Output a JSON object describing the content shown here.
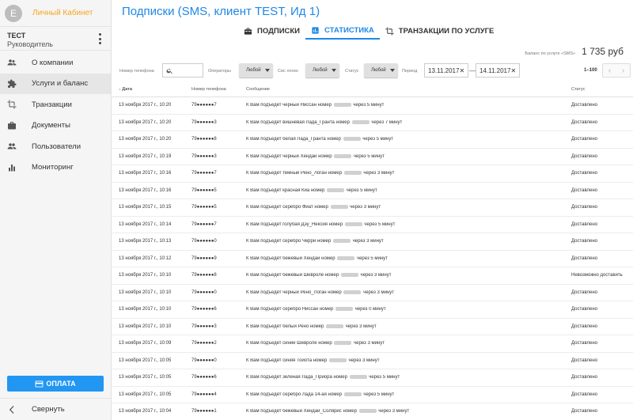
{
  "sidebar": {
    "avatar_letter": "E",
    "cabinet_label": "Личный Кабинет",
    "user_name": "ТЕСТ",
    "user_role": "Руководитель",
    "items": [
      {
        "label": "О компании",
        "icon": "users-icon"
      },
      {
        "label": "Услуги и баланс",
        "icon": "puzzle-icon",
        "active": true
      },
      {
        "label": "Транзакции",
        "icon": "crop-icon"
      },
      {
        "label": "Документы",
        "icon": "briefcase-icon"
      },
      {
        "label": "Пользователи",
        "icon": "people-icon"
      },
      {
        "label": "Мониторинг",
        "icon": "bar-chart-icon"
      }
    ],
    "pay_label": "ОПЛАТА",
    "collapse_label": "Свернуть"
  },
  "header": {
    "title": "Подписки (SMS, клиент TEST, Ид 1)",
    "tabs": [
      {
        "label": "ПОДПИСКИ",
        "icon": "toolbox-icon",
        "active": false
      },
      {
        "label": "СТАТИСТИКА",
        "icon": "chart-icon",
        "active": true
      },
      {
        "label": "ТРАНЗАКЦИИ ПО УСЛУГЕ",
        "icon": "crop-icon",
        "active": false
      }
    ],
    "balance_label": "Баланс по услуге «SMS»",
    "balance_value": "1 735 руб"
  },
  "filters": {
    "phone_label": "Номер телефона",
    "operators_label": "Операторы",
    "operators_value": "Любой",
    "sys_label": "Сис логин",
    "sys_value": "Любой",
    "status_label": "Статус",
    "status_value": "Любой",
    "period_label": "Период",
    "date_from": "13.11.2017",
    "date_to": "14.11.2017",
    "dash": "—",
    "pager_text": "1–100"
  },
  "table": {
    "headers": {
      "date": "Дата",
      "phone": "Номер телефона",
      "message": "Сообщение",
      "status": "Статус"
    },
    "rows": [
      {
        "date": "13 ноября 2017 г., 10:20",
        "phone": "79●●●●●●7",
        "msg_a": "К Вам подъедет черный Ниссан номер",
        "msg_b": "через 5 минут",
        "status": "Доставлено"
      },
      {
        "date": "13 ноября 2017 г., 10:20",
        "phone": "79●●●●●●3",
        "msg_a": "К Вам подъедет вишневая Лада_Гранта номер",
        "msg_b": "через 7 минут",
        "status": "Доставлено"
      },
      {
        "date": "13 ноября 2017 г., 10:20",
        "phone": "79●●●●●●8",
        "msg_a": "К Вам подъедет белая Лада_Гранта номер",
        "msg_b": "через 5 минут",
        "status": "Доставлено"
      },
      {
        "date": "13 ноября 2017 г., 10:19",
        "phone": "79●●●●●●3",
        "msg_a": "К Вам подъедет черный Хендай номер",
        "msg_b": "через 5 минут",
        "status": "Доставлено"
      },
      {
        "date": "13 ноября 2017 г., 10:16",
        "phone": "79●●●●●●7",
        "msg_a": "К Вам подъедет темный Рено_Логан номер",
        "msg_b": "через 3 минут",
        "status": "Доставлено"
      },
      {
        "date": "13 ноября 2017 г., 10:16",
        "phone": "79●●●●●●5",
        "msg_a": "К Вам подъедет красная Киа номер",
        "msg_b": "через 5 минут",
        "status": "Доставлено"
      },
      {
        "date": "13 ноября 2017 г., 10:15",
        "phone": "79●●●●●●5",
        "msg_a": "К Вам подъедет серебро Фиат номер",
        "msg_b": "через 3 минут",
        "status": "Доставлено"
      },
      {
        "date": "13 ноября 2017 г., 10:14",
        "phone": "79●●●●●●7",
        "msg_a": "К Вам подъедет голубая Дэу_Нексия номер",
        "msg_b": "через 5 минут",
        "status": "Доставлено"
      },
      {
        "date": "13 ноября 2017 г., 10:13",
        "phone": "79●●●●●●0",
        "msg_a": "К Вам подъедет серебро Черри номер",
        "msg_b": "через 3 минут",
        "status": "Доставлено"
      },
      {
        "date": "13 ноября 2017 г., 10:12",
        "phone": "79●●●●●●9",
        "msg_a": "К Вам подъедет бежевый Хендай номер",
        "msg_b": "через 5 минут",
        "status": "Доставлено"
      },
      {
        "date": "13 ноября 2017 г., 10:10",
        "phone": "79●●●●●●8",
        "msg_a": "К Вам подъедет бежевый Шевроле номер",
        "msg_b": "через 3 минут",
        "status": "Невозможно доставить"
      },
      {
        "date": "13 ноября 2017 г., 10:10",
        "phone": "79●●●●●●0",
        "msg_a": "К Вам подъедет черный Рено_Логан номер",
        "msg_b": "через 3 минут",
        "status": "Доставлено"
      },
      {
        "date": "13 ноября 2017 г., 10:10",
        "phone": "79●●●●●●6",
        "msg_a": "К Вам подъедет серебро Ниссан номер",
        "msg_b": "через 0 минут",
        "status": "Доставлено"
      },
      {
        "date": "13 ноября 2017 г., 10:10",
        "phone": "79●●●●●●3",
        "msg_a": "К Вам подъедет белый Рено номер",
        "msg_b": "через 3 минут",
        "status": "Доставлено"
      },
      {
        "date": "13 ноября 2017 г., 10:09",
        "phone": "79●●●●●●2",
        "msg_a": "К Вам подъедет синий Шевроле номер",
        "msg_b": "через 3 минут",
        "status": "Доставлено"
      },
      {
        "date": "13 ноября 2017 г., 10:05",
        "phone": "79●●●●●●0",
        "msg_a": "К Вам подъедет синяя Тойота номер",
        "msg_b": "через 3 минут",
        "status": "Доставлено"
      },
      {
        "date": "13 ноября 2017 г., 10:05",
        "phone": "79●●●●●●6",
        "msg_a": "К Вам подъедет зеленая Лада_Приора номер",
        "msg_b": "через 5 минут",
        "status": "Доставлено"
      },
      {
        "date": "13 ноября 2017 г., 10:05",
        "phone": "79●●●●●●4",
        "msg_a": "К Вам подъедет серебро Лада 14-ая номер",
        "msg_b": "через 5 минут",
        "status": "Доставлено"
      },
      {
        "date": "13 ноября 2017 г., 10:04",
        "phone": "79●●●●●●1",
        "msg_a": "К Вам подъедет бежевый Хёндай_Солярис номер",
        "msg_b": "через 3 минут",
        "status": "Доставлено"
      }
    ]
  },
  "colors": {
    "accent": "#1e88e5",
    "cabinet": "#f5a623",
    "pay_button": "#2196f3"
  }
}
